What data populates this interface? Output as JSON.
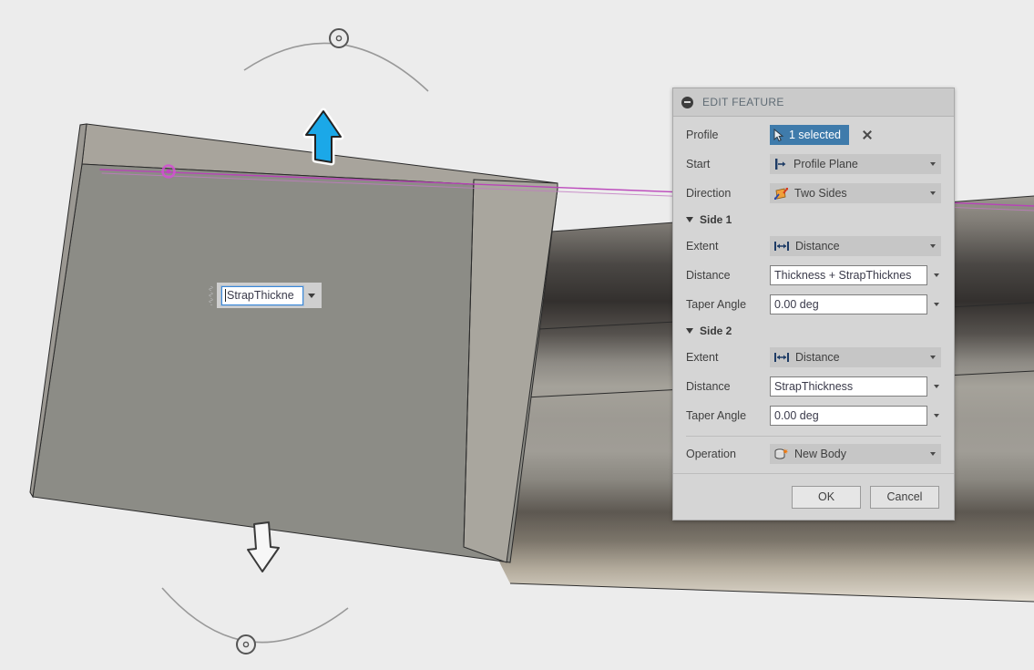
{
  "app": {
    "viewport_background": "#ececec",
    "accent_blue": "#3f7bab",
    "sketch_magenta": "#b13fb1",
    "body_grey": "#8c8c86"
  },
  "canvas": {
    "inline_dimension": {
      "name": "distance-manipulator-input",
      "value": "StrapThickne",
      "has_caret": true,
      "dropdown_icon": "chevron-down-icon"
    },
    "manipulators": {
      "top_arrow": {
        "icon": "arrow-up-icon",
        "state": "selected",
        "color": "#1ba1e2"
      },
      "bottom_arrow": {
        "icon": "arrow-down-icon",
        "state": "normal",
        "color": "#ffffff"
      },
      "top_rotate_handle": {
        "icon": "rotation-handle-icon"
      },
      "bottom_rotate_handle": {
        "icon": "rotation-handle-icon"
      }
    },
    "sketch_point": {
      "icon": "sketch-point-icon",
      "color": "#cc44bb"
    }
  },
  "dialog": {
    "title": "EDIT FEATURE",
    "collapse_icon": "collapse-minus-icon",
    "rows": {
      "profile": {
        "label": "Profile",
        "selection_icon": "cursor-select-icon",
        "value": "1 selected",
        "clear_icon": "clear-selection-x-icon"
      },
      "start": {
        "label": "Start",
        "icon": "profile-plane-icon",
        "value": "Profile Plane",
        "caret": "chevron-down-icon"
      },
      "direction": {
        "label": "Direction",
        "icon": "two-sides-icon",
        "value": "Two Sides",
        "caret": "chevron-down-icon"
      }
    },
    "side1": {
      "header": "Side 1",
      "extent": {
        "label": "Extent",
        "icon": "distance-extent-icon",
        "value": "Distance",
        "caret": "chevron-down-icon"
      },
      "distance": {
        "label": "Distance",
        "value": "Thickness + StrapThicknes",
        "caret": "chevron-down-icon"
      },
      "taper": {
        "label": "Taper Angle",
        "value": "0.00 deg",
        "caret": "chevron-down-icon"
      }
    },
    "side2": {
      "header": "Side 2",
      "extent": {
        "label": "Extent",
        "icon": "distance-extent-icon",
        "value": "Distance",
        "caret": "chevron-down-icon"
      },
      "distance": {
        "label": "Distance",
        "value": "StrapThickness",
        "caret": "chevron-down-icon"
      },
      "taper": {
        "label": "Taper Angle",
        "value": "0.00 deg",
        "caret": "chevron-down-icon"
      }
    },
    "operation": {
      "label": "Operation",
      "icon": "new-body-icon",
      "value": "New Body",
      "caret": "chevron-down-icon"
    },
    "footer": {
      "ok": "OK",
      "cancel": "Cancel"
    }
  }
}
